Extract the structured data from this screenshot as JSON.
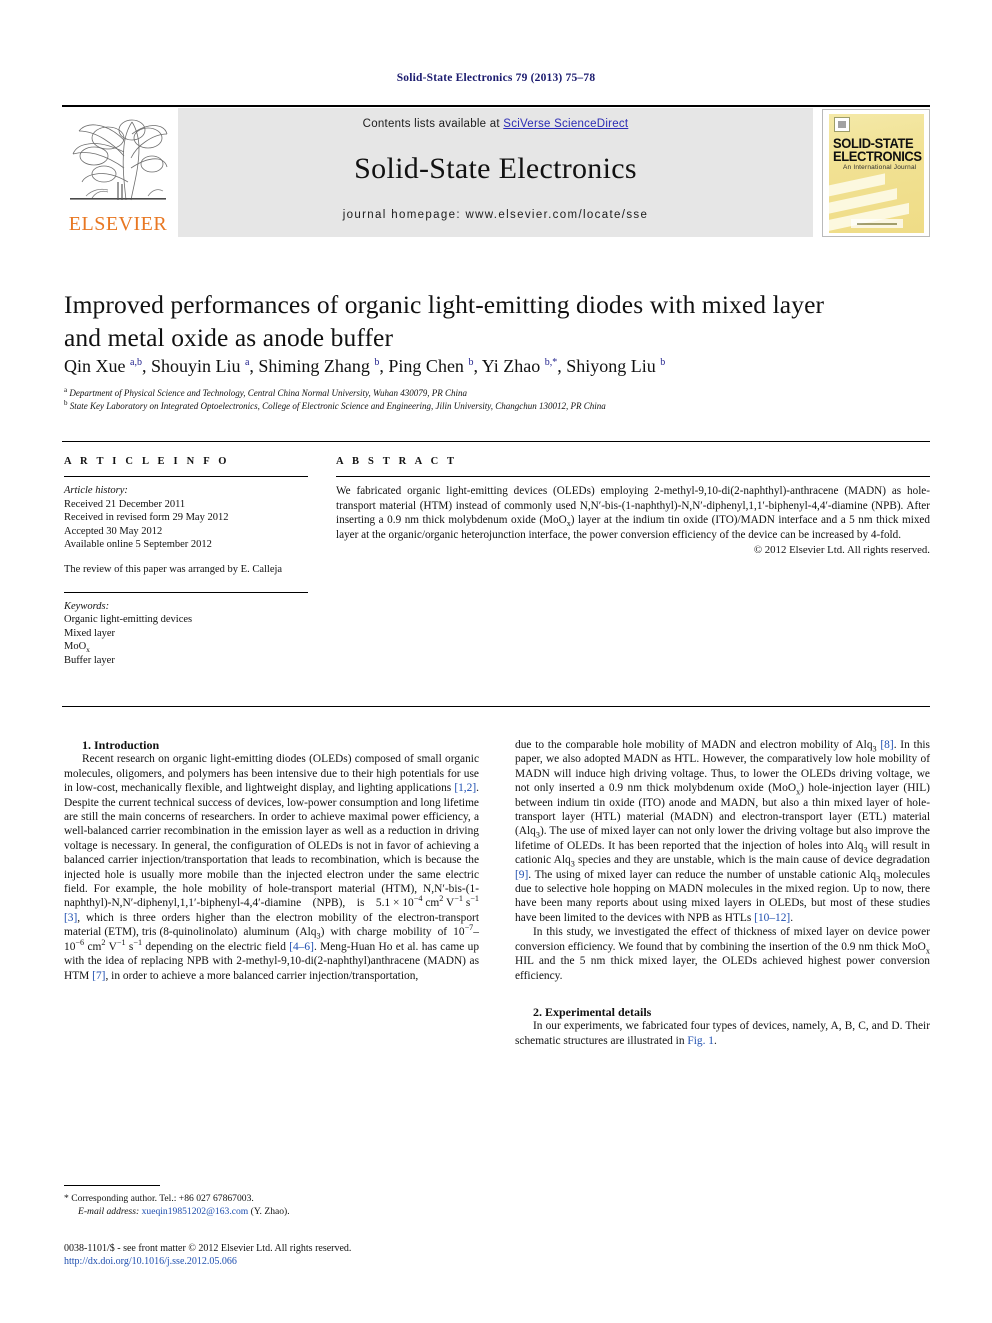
{
  "running_head": "Solid-State Electronics 79 (2013) 75–78",
  "masthead": {
    "contents_prefix": "Contents lists available at ",
    "sciencedirect_link": "SciVerse ScienceDirect",
    "journal_title": "Solid-State Electronics",
    "homepage": "journal homepage: www.elsevier.com/locate/sse",
    "publisher_logo_text": "ELSEVIER",
    "cover": {
      "line1": "SOLID-STATE",
      "line2": "ELECTRONICS",
      "subtitle": "An International Journal"
    }
  },
  "article": {
    "title": "Improved performances of organic light-emitting diodes with mixed layer and metal oxide as anode buffer",
    "authors_html": "Qin Xue <sup>a,b</sup>, Shouyin Liu <sup>a</sup>, Shiming Zhang <sup>b</sup>, Ping Chen <sup>b</sup>, Yi Zhao <sup>b,</sup><sup>*</sup>, Shiyong Liu <sup>b</sup>",
    "affiliation_a": "Department of Physical Science and Technology, Central China Normal University, Wuhan 430079, PR China",
    "affiliation_b": "State Key Laboratory on Integrated Optoelectronics, College of Electronic Science and Engineering, Jilin University, Changchun 130012, PR China"
  },
  "article_info": {
    "heading": "A R T I C L E   I N F O",
    "history_label": "Article history:",
    "history": [
      "Received 21 December 2011",
      "Received in revised form 29 May 2012",
      "Accepted 30 May 2012",
      "Available online 5 September 2012"
    ],
    "review_note": "The review of this paper was arranged by E. Calleja",
    "keywords_label": "Keywords:",
    "keywords_html": [
      "Organic light-emitting devices",
      "Mixed layer",
      "MoO<sub>x</sub>",
      "Buffer layer"
    ]
  },
  "abstract": {
    "heading": "A B S T R A C T",
    "text_html": "We fabricated organic light-emitting devices (OLEDs) employing 2-methyl-9,10-di(2-naphthyl)-anthracene (MADN) as hole-transport material (HTM) instead of commonly used N,N′-bis-(1-naphthyl)-N,N′-diphenyl,1,1′-biphenyl-4,4′-diamine (NPB). After inserting a 0.9 nm thick molybdenum oxide (MoO<sub>x</sub>) layer at the indium tin oxide (ITO)/MADN interface and a 5 nm thick mixed layer at the organic/organic heterojunction interface, the power conversion efficiency of the device can be increased by 4-fold.",
    "copyright": "© 2012 Elsevier Ltd. All rights reserved."
  },
  "body": {
    "left": {
      "heading1": "1. Introduction",
      "para1_html": "Recent research on organic light-emitting diodes (OLEDs) composed of small organic molecules, oligomers, and polymers has been intensive due to their high potentials for use in low-cost, mechanically flexible, and lightweight display, and lighting applications <span class=\"ref\">[1,2]</span>. Despite the current technical success of devices, low-power consumption and long lifetime are still the main concerns of researchers. In order to achieve maximal power efficiency, a well-balanced carrier recombination in the emission layer as well as a reduction in driving voltage is necessary. In general, the configuration of OLEDs is not in favor of achieving a balanced carrier injection/transportation that leads to recombination, which is because the injected hole is usually more mobile than the injected electron under the same electric field. For example, the hole mobility of hole-transport material (HTM), N,N′-bis-(1-naphthyl)-N,N′-diphenyl,1,1′-biphenyl-4,4′-diamine&nbsp;&nbsp;&nbsp;&nbsp;(NPB),&nbsp;&nbsp;&nbsp;&nbsp;is&nbsp;&nbsp;&nbsp;&nbsp;5.1&nbsp;×&nbsp;10<sup class=\"num\">−4</sup> cm<sup class=\"num\">2</sup> V<sup class=\"num\">−1</sup> s<sup class=\"num\">−1</sup> <span class=\"ref\">[3]</span>, which is three orders higher than the electron mobility of the electron-transport material (ETM), tris (8-quinolinolato)&nbsp;&nbsp;aluminum&nbsp;&nbsp;(Alq<sub>3</sub>)&nbsp;&nbsp;with&nbsp;&nbsp;charge&nbsp;&nbsp;mobility&nbsp;&nbsp;of&nbsp;&nbsp;10<sup class=\"num\">−7</sup>–10<sup class=\"num\">−6</sup> cm<sup class=\"num\">2</sup> V<sup class=\"num\">−1</sup> s<sup class=\"num\">−1</sup> depending on the electric field <span class=\"ref\">[4–6]</span>. Meng-Huan Ho et al. has came up with the idea of replacing NPB with 2-methyl-9,10-di(2-naphthyl)anthracene (MADN) as HTM <span class=\"ref\">[7]</span>, in order to achieve a more balanced carrier injection/transportation,"
    },
    "right": {
      "para1_html": "due to the comparable hole mobility of MADN and electron mobility of Alq<sub>3</sub> <span class=\"ref\">[8]</span>. In this paper, we also adopted MADN as HTL. However, the comparatively low hole mobility of MADN will induce high driving voltage. Thus, to lower the OLEDs driving voltage, we not only inserted a 0.9 nm thick molybdenum oxide (MoO<sub>x</sub>) hole-injection layer (HIL) between indium tin oxide (ITO) anode and MADN, but also a thin mixed layer of hole-transport layer (HTL) material (MADN) and electron-transport layer (ETL) material (Alq<sub>3</sub>). The use of mixed layer can not only lower the driving voltage but also improve the lifetime of OLEDs. It has been reported that the injection of holes into Alq<sub>3</sub> will result in cationic Alq<sub>3</sub> species and they are unstable, which is the main cause of device degradation <span class=\"ref\">[9]</span>. The using of mixed layer can reduce the number of unstable cationic Alq<sub>3</sub> molecules due to selective hole hopping on MADN molecules in the mixed region. Up to now, there have been many reports about using mixed layers in OLEDs, but most of these studies have been limited to the devices with NPB as HTLs <span class=\"ref\">[10–12]</span>.",
      "para2_html": "In this study, we investigated the effect of thickness of mixed layer on device power conversion efficiency. We found that by combining the insertion of the 0.9 nm thick MoO<sub>x</sub> HIL and the 5 nm thick mixed layer, the OLEDs achieved highest power conversion efficiency.",
      "heading2": "2. Experimental details",
      "para3_html": "In our experiments, we fabricated four types of devices, namely, A, B, C, and D. Their schematic structures are illustrated in <span class=\"ref\">Fig. 1</span>."
    }
  },
  "footnotes": {
    "corresponding_marker": "*",
    "corresponding_text": "Corresponding author. Tel.: +86 027 67867003.",
    "email_label": "E-mail address:",
    "email": "xueqin19851202@163.com",
    "email_suffix": "(Y. Zhao).",
    "imprint_line1": "0038-1101/$ - see front matter © 2012 Elsevier Ltd. All rights reserved.",
    "imprint_doi": "http://dx.doi.org/10.1016/j.sse.2012.05.066"
  },
  "colors": {
    "link_blue": "#2b2bb4",
    "ref_blue": "#1f4fb0",
    "running_head": "#1a1a6e",
    "elsevier_orange": "#e87722",
    "band_gray": "#e6e6e6"
  }
}
